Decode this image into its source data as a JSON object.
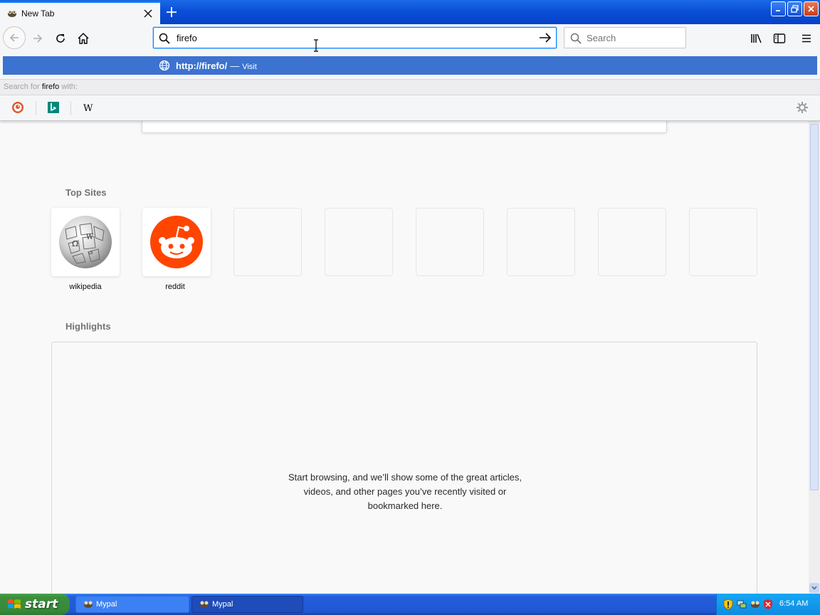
{
  "window": {
    "tab_title": "New Tab"
  },
  "navbar": {
    "url_value": "firefo",
    "search_placeholder": "Search"
  },
  "url_popup": {
    "result_url": "http://firefo/",
    "result_separator": "—",
    "result_action": "Visit",
    "search_with_prefix": "Search for ",
    "search_with_term": "firefo",
    "search_with_suffix": " with:",
    "engines": [
      "duckduckgo-icon",
      "bing-icon",
      "wikipedia-icon"
    ]
  },
  "newtab": {
    "top_sites_title": "Top Sites",
    "top_sites": [
      {
        "label": "wikipedia",
        "icon": "wikipedia-globe-icon"
      },
      {
        "label": "reddit",
        "icon": "reddit-icon"
      }
    ],
    "highlights_title": "Highlights",
    "highlights_empty_lines": [
      "Start browsing, and we’ll show some of the great articles,",
      "videos, and other pages you’ve recently visited or",
      "bookmarked here."
    ]
  },
  "taskbar": {
    "start_label": "start",
    "tasks": [
      {
        "label": "Mypal",
        "state": "inactive"
      },
      {
        "label": "Mypal",
        "state": "active"
      }
    ],
    "clock": "6:54 AM"
  },
  "colors": {
    "accent": "#0a84ff",
    "selected_row": "#3c72d0",
    "reddit": "#ff4500",
    "xp_taskbar": "#245edb",
    "xp_start": "#3c8f3c"
  }
}
